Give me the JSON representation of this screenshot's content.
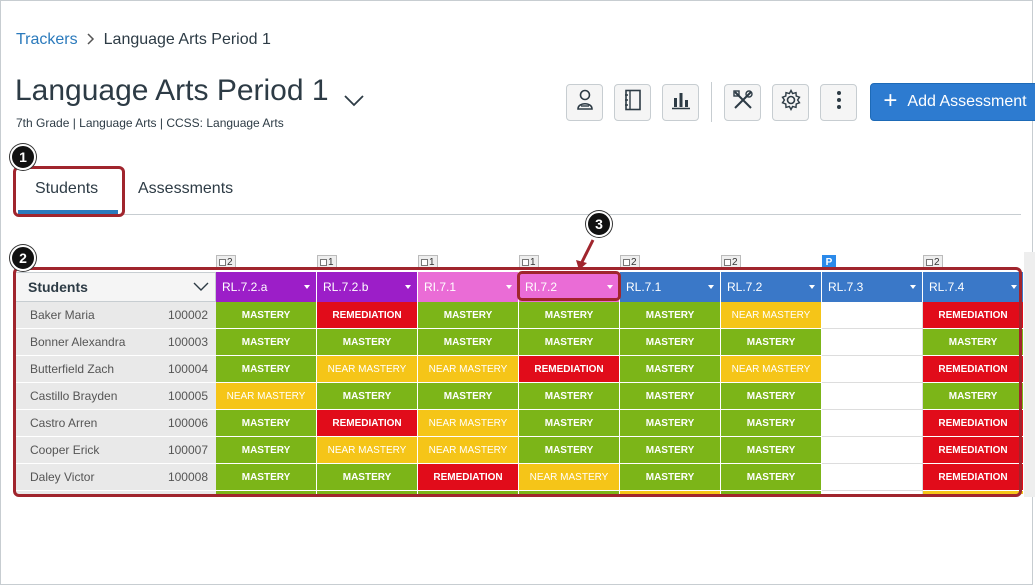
{
  "breadcrumb": {
    "root": "Trackers",
    "current": "Language Arts Period 1"
  },
  "page": {
    "title": "Language Arts Period 1",
    "subtitle": "7th Grade  |  Language Arts  |  CCSS: Language Arts"
  },
  "toolbar": {
    "buttons": [
      "student-view-icon",
      "notebook-icon",
      "bar-chart-icon",
      "tools-icon",
      "gear-icon",
      "more-icon"
    ],
    "add_label": "Add Assessment"
  },
  "tabs": [
    {
      "label": "Students",
      "active": true
    },
    {
      "label": "Assessments",
      "active": false
    }
  ],
  "callouts": [
    "1",
    "2",
    "3"
  ],
  "grid": {
    "students_header": "Students",
    "columns": [
      {
        "label": "RL.7.2.a",
        "count": "2",
        "color": "#9c1ec8",
        "count_type": "check"
      },
      {
        "label": "RL.7.2.b",
        "count": "1",
        "color": "#9c1ec8",
        "count_type": "check"
      },
      {
        "label": "RI.7.1",
        "count": "1",
        "color": "#ea6cd6",
        "count_type": "check"
      },
      {
        "label": "RI.7.2",
        "count": "1",
        "color": "#ea6cd6",
        "count_type": "check"
      },
      {
        "label": "RL.7.1",
        "count": "2",
        "color": "#3a78c8",
        "count_type": "check"
      },
      {
        "label": "RL.7.2",
        "count": "2",
        "color": "#3a78c8",
        "count_type": "check"
      },
      {
        "label": "RL.7.3",
        "count": "P",
        "color": "#3a78c8",
        "count_type": "p"
      },
      {
        "label": "RL.7.4",
        "count": "2",
        "color": "#3a78c8",
        "count_type": "check"
      }
    ],
    "rows": [
      {
        "name": "Baker Maria",
        "id": "100002",
        "scores": [
          "MASTERY",
          "REMEDIATION",
          "MASTERY",
          "MASTERY",
          "MASTERY",
          "NEAR MASTERY",
          "",
          "REMEDIATION"
        ]
      },
      {
        "name": "Bonner Alexandra",
        "id": "100003",
        "scores": [
          "MASTERY",
          "MASTERY",
          "MASTERY",
          "MASTERY",
          "MASTERY",
          "MASTERY",
          "",
          "MASTERY"
        ]
      },
      {
        "name": "Butterfield Zach",
        "id": "100004",
        "scores": [
          "MASTERY",
          "NEAR MASTERY",
          "NEAR MASTERY",
          "REMEDIATION",
          "MASTERY",
          "NEAR MASTERY",
          "",
          "REMEDIATION"
        ]
      },
      {
        "name": "Castillo Brayden",
        "id": "100005",
        "scores": [
          "NEAR MASTERY",
          "MASTERY",
          "MASTERY",
          "MASTERY",
          "MASTERY",
          "MASTERY",
          "",
          "MASTERY"
        ]
      },
      {
        "name": "Castro Arren",
        "id": "100006",
        "scores": [
          "MASTERY",
          "REMEDIATION",
          "NEAR MASTERY",
          "MASTERY",
          "MASTERY",
          "MASTERY",
          "",
          "REMEDIATION"
        ]
      },
      {
        "name": "Cooper Erick",
        "id": "100007",
        "scores": [
          "MASTERY",
          "NEAR MASTERY",
          "NEAR MASTERY",
          "MASTERY",
          "MASTERY",
          "MASTERY",
          "",
          "REMEDIATION"
        ]
      },
      {
        "name": "Daley Victor",
        "id": "100008",
        "scores": [
          "MASTERY",
          "MASTERY",
          "REMEDIATION",
          "NEAR MASTERY",
          "MASTERY",
          "MASTERY",
          "",
          "REMEDIATION"
        ]
      }
    ]
  },
  "colors": {
    "accent": "#2b7abc",
    "mastery": "#7cb518",
    "near_mastery": "#f5c518",
    "remediation": "#e10c1a",
    "highlight": "#a0252d"
  }
}
